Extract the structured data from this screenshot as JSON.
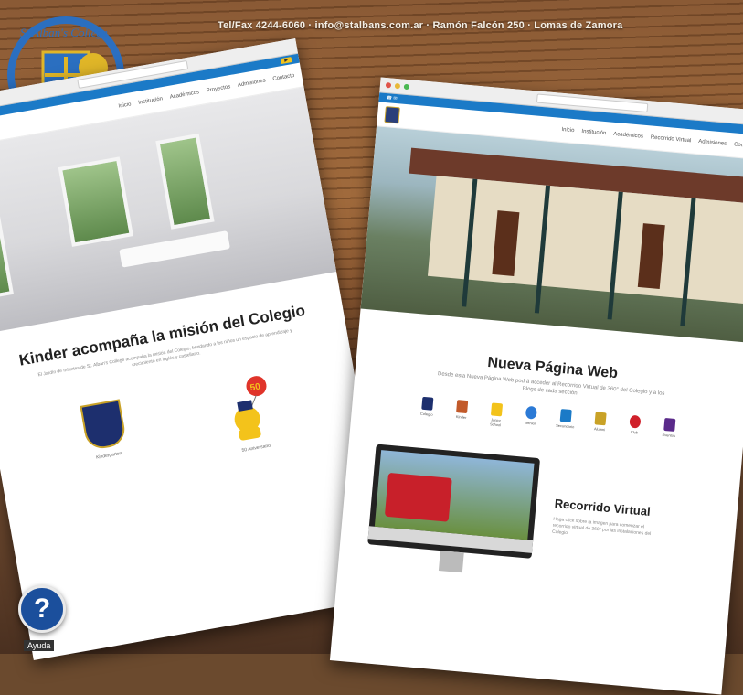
{
  "contact_line": "Tel/Fax 4244-6060 · info@stalbans.com.ar · Ramón Falcón 250 · Lomas de Zamora",
  "crest": {
    "text": "St Alban's College"
  },
  "help": {
    "glyph": "?",
    "label": "Ayuda"
  },
  "screen_left": {
    "nav_items": [
      "Inicio",
      "Institución",
      "Académicos",
      "Proyectos",
      "Admisiones",
      "Contacto"
    ],
    "heading": "Kinder acompaña la misión del Colegio",
    "body": "El Jardín de Infantes de St. Alban's College acompaña la misión del Colegio, brindando a los niños un espacio de aprendizaje y crecimiento en inglés y castellano.",
    "card1_caption": "Kindergarten",
    "card2_caption": "50 Aniversario",
    "balloon_text": "50"
  },
  "screen_right": {
    "nav_items": [
      "Inicio",
      "Institución",
      "Académicos",
      "Recorrido Virtual",
      "Admisiones",
      "Comunidad"
    ],
    "heading": "Nueva Página Web",
    "body": "Desde esta Nueva Página Web podrá acceder al Recorrido Virtual de 360° del Colegio y a los Blogs de cada sección.",
    "icons": [
      "Colegio",
      "Kinder",
      "Junior School",
      "Senior",
      "Secundario",
      "Alumni",
      "Club",
      "Eventos"
    ],
    "tour_title": "Recorrido Virtual",
    "tour_body": "Haga click sobre la imagen para comenzar el recorrido virtual de 360° por las instalaciones del Colegio."
  },
  "colors": {
    "accent_blue": "#1b7ac7",
    "brand_navy": "#1d2f6e",
    "button_yellow": "#f3c31b",
    "crest_gold": "#c9a227"
  }
}
